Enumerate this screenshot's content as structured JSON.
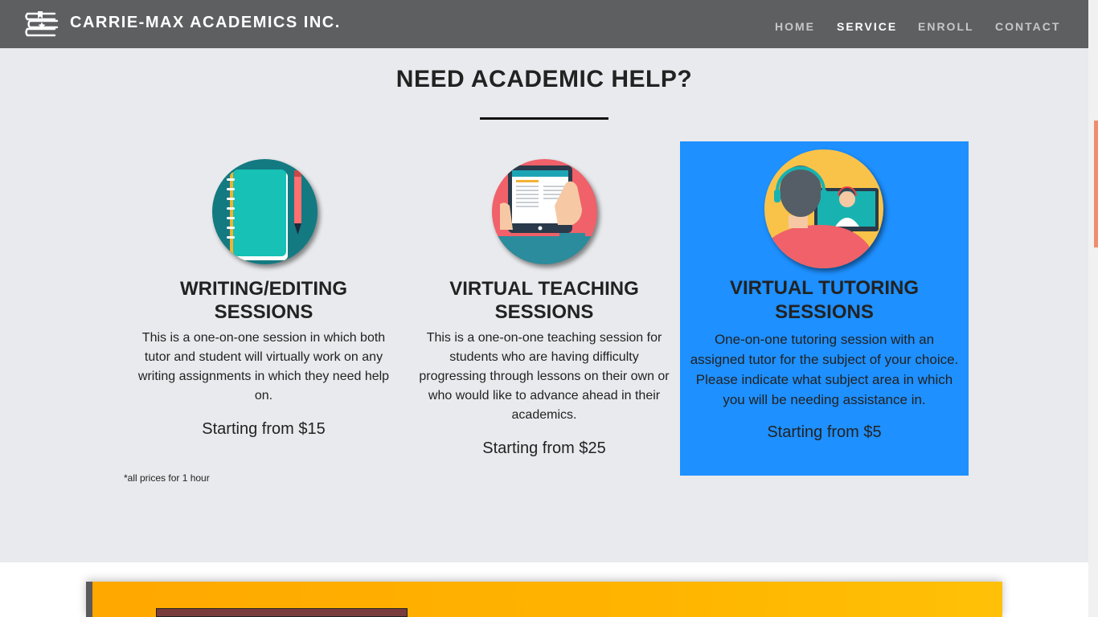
{
  "header": {
    "brand": "CARRIE-MAX ACADEMICS INC.",
    "nav": [
      {
        "label": "HOME",
        "active": false
      },
      {
        "label": "SERVICE",
        "active": true
      },
      {
        "label": "ENROLL",
        "active": false
      },
      {
        "label": "CONTACT",
        "active": false
      }
    ]
  },
  "services": {
    "title": "NEED ACADEMIC HELP?",
    "cards": [
      {
        "icon": "notebook-pencil-icon",
        "title_line1": "WRITING/EDITING",
        "title_line2": "SESSIONS",
        "desc_lines": [
          "This is a one-on-one session in which both",
          "tutor and student will virtually work on any",
          "writing assignments in which they need help",
          "on."
        ],
        "price": "Starting from $15"
      },
      {
        "icon": "tablet-ebook-icon",
        "title_line1": "VIRTUAL TEACHING",
        "title_line2": "SESSIONS",
        "desc_lines": [
          "This is a one-on-one teaching session for",
          "students who are having difficulty",
          "progressing through lessons on their own or",
          "who would like to advance ahead in their",
          "academics."
        ],
        "price": "Starting from $25"
      },
      {
        "icon": "video-tutoring-icon",
        "title_line1": "VIRTUAL TUTORING",
        "title_line2": "SESSIONS",
        "desc_lines": [
          "One-on-one tutoring session with an",
          "assigned tutor for the subject of your choice.",
          "Please indicate what subject area in which",
          "you will be needing assistance in."
        ],
        "price": "Starting from $5",
        "highlight_color": "#1e90ff"
      }
    ],
    "note": "*all prices for 1 hour"
  },
  "colors": {
    "navbar": "#5e5f61",
    "section_bg": "#e8eaed",
    "highlight": "#1e90ff",
    "banner": "#ffb000"
  }
}
